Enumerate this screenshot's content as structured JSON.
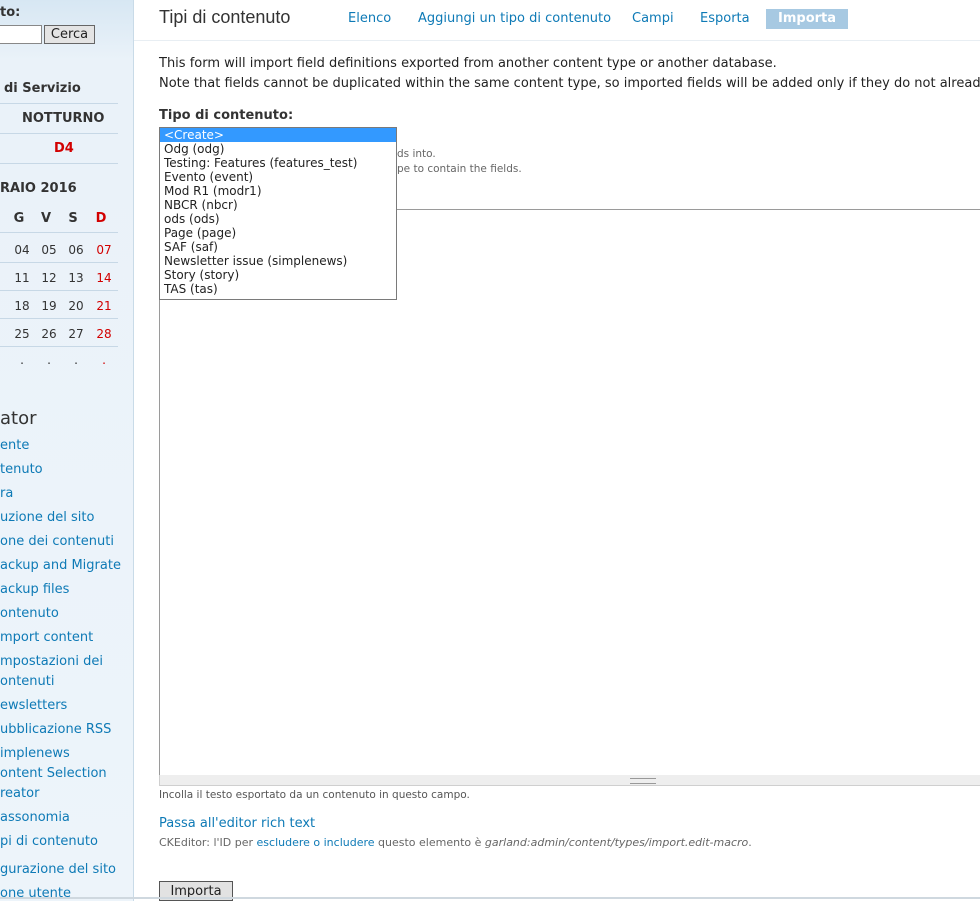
{
  "sidebar": {
    "search_label": "to:",
    "search_value": "",
    "search_button": "Cerca",
    "service_heading": "di Servizio",
    "shift": "NOTTURNO",
    "shift_code": "D4",
    "calendar": {
      "month": "RAIO 2016",
      "day_headers": [
        "G",
        "V",
        "S",
        "D"
      ],
      "rows": [
        [
          "04",
          "05",
          "06",
          "07"
        ],
        [
          "11",
          "12",
          "13",
          "14"
        ],
        [
          "18",
          "19",
          "20",
          "21"
        ],
        [
          "25",
          "26",
          "27",
          "28"
        ],
        [
          ".",
          ".",
          ".",
          "."
        ]
      ]
    },
    "menu_title": "ator",
    "menu_items": [
      "ente",
      "tenuto",
      "ra",
      "uzione del sito",
      "one dei contenuti",
      "ackup and Migrate",
      "ackup files",
      "ontenuto",
      "mport content",
      "mpostazioni dei",
      "ontenuti",
      "ewsletters",
      "ubblicazione RSS",
      "implenews",
      "ontent Selection",
      "reator",
      "assonomia",
      "pi di contenuto",
      "gurazione del sito",
      "one utente"
    ]
  },
  "main": {
    "title": "Tipi di contenuto",
    "tabs": [
      "Elenco",
      "Aggiungi un tipo di contenuto",
      "Campi",
      "Esporta",
      "Importa"
    ],
    "intro_line1": "This form will import field definitions exported from another content type or another database.",
    "intro_line2": "Note that fields cannot be duplicated within the same content type, so imported fields will be added only if they do not already exi",
    "field_label": "Tipo di contenuto:",
    "hint_line1": "ds into.",
    "hint_line2": "pe to contain the fields.",
    "select_options": [
      "<Create>",
      "Odg (odg)",
      "Testing: Features (features_test)",
      "Evento (event)",
      "Mod R1 (modr1)",
      "NBCR (nbcr)",
      "ods (ods)",
      "Page (page)",
      "SAF (saf)",
      "Newsletter issue (simplenews)",
      "Story (story)",
      "TAS (tas)"
    ],
    "selected_option": "<Create>",
    "textarea_value": "",
    "description": "Incolla il testo esportato da un contenuto in questo campo.",
    "rich_text_link": "Passa all'editor rich text",
    "ckeditor_prefix": "CKEditor: l'ID per",
    "ckeditor_link": "escludere o includere",
    "ckeditor_middle": "questo elemento è",
    "ckeditor_id": "garland:admin/content/types/import.edit-macro",
    "ckeditor_suffix": ".",
    "submit": "Importa"
  },
  "colors": {
    "link": "#0e7ab6",
    "active_tab_bg": "#a7c9e2",
    "sunday_red": "#d20000",
    "selected_option": "#3399ff"
  }
}
